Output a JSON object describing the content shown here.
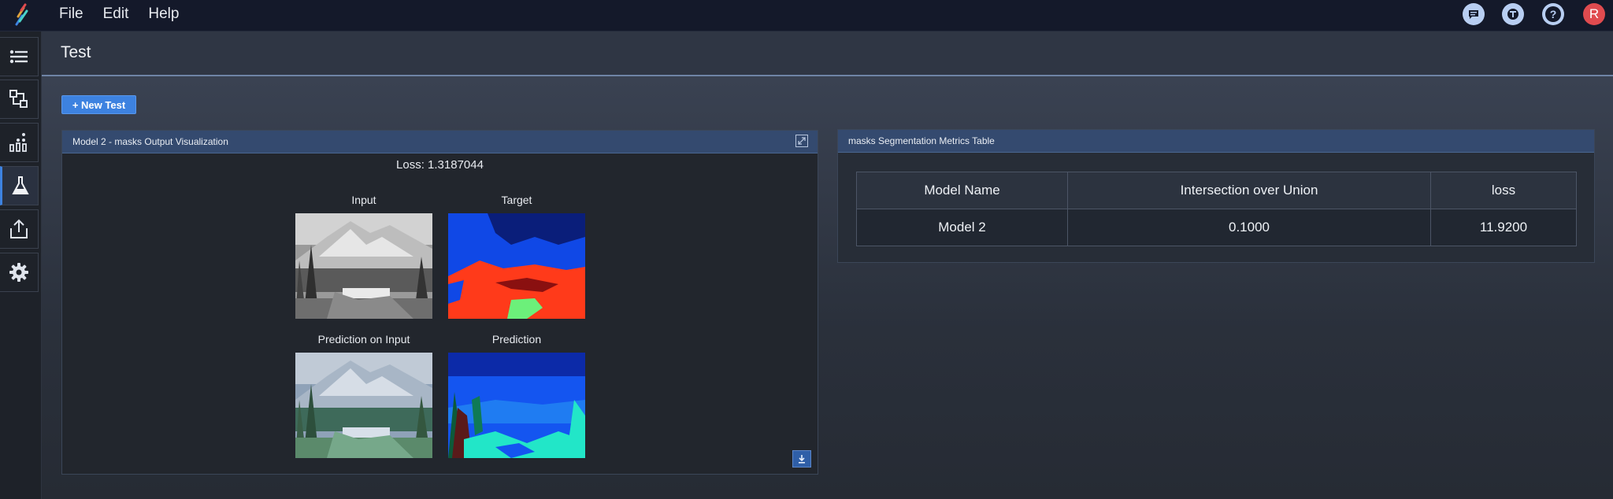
{
  "menu": {
    "file": "File",
    "edit": "Edit",
    "help": "Help"
  },
  "header_icons": [
    "chat-icon",
    "ml-icon",
    "help-icon"
  ],
  "user": {
    "avatar_initial": "R"
  },
  "sidebar": {
    "items": [
      {
        "name": "layers-icon"
      },
      {
        "name": "model-graph-icon"
      },
      {
        "name": "analytics-icon"
      },
      {
        "name": "flask-icon",
        "active": true
      },
      {
        "name": "export-icon"
      },
      {
        "name": "gear-icon"
      }
    ]
  },
  "page": {
    "title": "Test"
  },
  "toolbar": {
    "new_test_label": "+ New Test"
  },
  "viz_panel": {
    "title": "Model 2 - masks Output Visualization",
    "loss_text": "Loss: 1.3187044",
    "images": [
      {
        "label": "Input"
      },
      {
        "label": "Target"
      },
      {
        "label": "Prediction on Input"
      },
      {
        "label": "Prediction"
      }
    ]
  },
  "metrics_panel": {
    "title": "masks Segmentation Metrics Table",
    "columns": [
      "Model Name",
      "Intersection over Union",
      "loss"
    ],
    "rows": [
      [
        "Model 2",
        "0.1000",
        "11.9200"
      ]
    ]
  },
  "colors": {
    "accent": "#3d82e0",
    "panel_header": "#344a6f",
    "avatar": "#e04b4f"
  }
}
